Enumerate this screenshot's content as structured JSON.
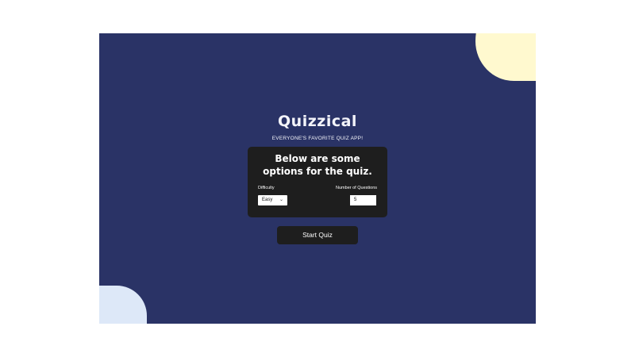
{
  "app": {
    "title": "Quizzical",
    "subtitle": "EVERYONE'S FAVORITE QUIZ APP!"
  },
  "options_panel": {
    "heading_line1": "Below are some",
    "heading_line2": "options for the quiz.",
    "difficulty_label": "Difficulty",
    "difficulty_value": "Easy",
    "questions_label": "Number of Questions",
    "questions_value": "5"
  },
  "start_button": {
    "label": "Start Quiz"
  },
  "colors": {
    "background": "#2a3366",
    "panel": "#1e1e1e",
    "blob_yellow": "#fff8cc",
    "blob_blue": "#dde8f8",
    "text": "#f4f5fb"
  },
  "icons": {
    "select_chevron": "chevron-down-icon"
  }
}
